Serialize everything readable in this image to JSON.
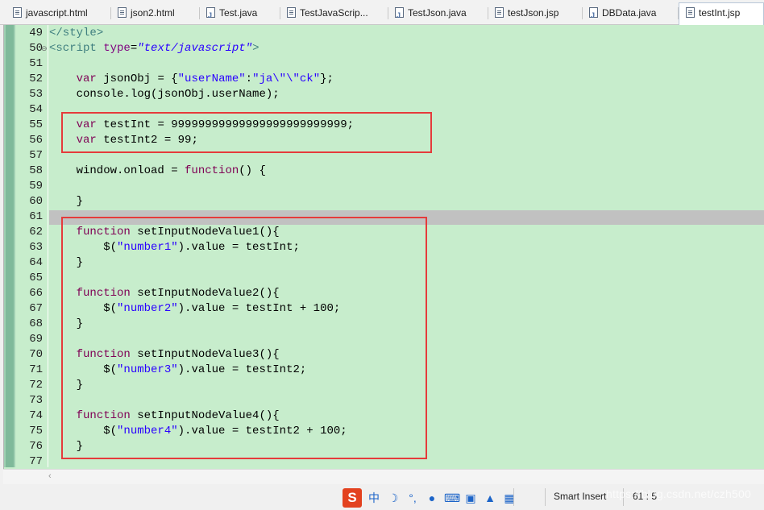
{
  "tabs": [
    {
      "label": "javascript.html",
      "icon": "file-icon"
    },
    {
      "label": "json2.html",
      "icon": "file-icon"
    },
    {
      "label": "Test.java",
      "icon": "java-file-icon"
    },
    {
      "label": "TestJavaScrip...",
      "icon": "file-icon"
    },
    {
      "label": "TestJson.java",
      "icon": "java-file-icon"
    },
    {
      "label": "testJson.jsp",
      "icon": "file-icon"
    },
    {
      "label": "DBData.java",
      "icon": "java-file-icon"
    },
    {
      "label": "testInt.jsp",
      "icon": "file-icon",
      "active": true
    }
  ],
  "editor": {
    "background": "#c7edcc",
    "current_line": 61,
    "lines": [
      {
        "n": "49",
        "text": "</style>"
      },
      {
        "n": "50",
        "text": "<script type=\"text/javascript\">"
      },
      {
        "n": "51",
        "text": ""
      },
      {
        "n": "52",
        "text": "    var jsonObj = {\"userName\":\"ja\\\"\\\"ck\"};"
      },
      {
        "n": "53",
        "text": "    console.log(jsonObj.userName);"
      },
      {
        "n": "54",
        "text": ""
      },
      {
        "n": "55",
        "text": "    var testInt = 99999999999999999999999999;"
      },
      {
        "n": "56",
        "text": "    var testInt2 = 99;"
      },
      {
        "n": "57",
        "text": ""
      },
      {
        "n": "58",
        "text": "    window.onload = function() {"
      },
      {
        "n": "59",
        "text": ""
      },
      {
        "n": "60",
        "text": "    }"
      },
      {
        "n": "61",
        "text": ""
      },
      {
        "n": "62",
        "text": "    function setInputNodeValue1(){"
      },
      {
        "n": "63",
        "text": "        $(\"number1\").value = testInt;"
      },
      {
        "n": "64",
        "text": "    }"
      },
      {
        "n": "65",
        "text": ""
      },
      {
        "n": "66",
        "text": "    function setInputNodeValue2(){"
      },
      {
        "n": "67",
        "text": "        $(\"number2\").value = testInt + 100;"
      },
      {
        "n": "68",
        "text": "    }"
      },
      {
        "n": "69",
        "text": ""
      },
      {
        "n": "70",
        "text": "    function setInputNodeValue3(){"
      },
      {
        "n": "71",
        "text": "        $(\"number3\").value = testInt2;"
      },
      {
        "n": "72",
        "text": "    }"
      },
      {
        "n": "73",
        "text": ""
      },
      {
        "n": "74",
        "text": "    function setInputNodeValue4(){"
      },
      {
        "n": "75",
        "text": "        $(\"number4\").value = testInt2 + 100;"
      },
      {
        "n": "76",
        "text": "    }"
      },
      {
        "n": "77",
        "text": ""
      }
    ]
  },
  "status": {
    "ime_logo": "S",
    "ime_mode": "中",
    "insert_mode": "Smart Insert",
    "cursor_position": "61 : 5",
    "watermark": "https://blog.csdn.net/czh500"
  }
}
